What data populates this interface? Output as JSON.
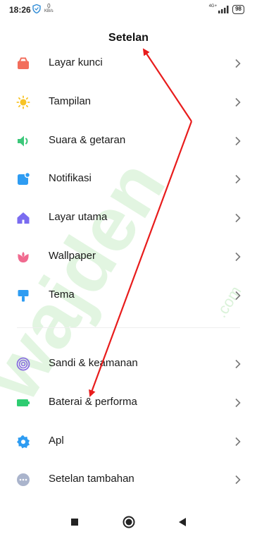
{
  "status_bar": {
    "time": "18:26",
    "speed_value": "0",
    "speed_unit": "KB/s",
    "network": "4G+",
    "battery": "98"
  },
  "header": {
    "title": "Setelan"
  },
  "settings": {
    "items": [
      {
        "label": "Layar kunci",
        "icon": "lock-screen-icon",
        "color": "#f26d5b"
      },
      {
        "label": "Tampilan",
        "icon": "sun-icon",
        "color": "#f7c325"
      },
      {
        "label": "Suara & getaran",
        "icon": "speaker-icon",
        "color": "#3cc77a"
      },
      {
        "label": "Notifikasi",
        "icon": "notification-icon",
        "color": "#2e9cf2"
      },
      {
        "label": "Layar utama",
        "icon": "home-icon",
        "color": "#7a6cf0"
      },
      {
        "label": "Wallpaper",
        "icon": "tulip-icon",
        "color": "#f06a8f"
      },
      {
        "label": "Tema",
        "icon": "paint-brush-icon",
        "color": "#2e9cf2"
      },
      {
        "label": "Sandi & keamanan",
        "icon": "fingerprint-icon",
        "color": "#8a6fe0"
      },
      {
        "label": "Baterai & performa",
        "icon": "battery-icon",
        "color": "#2ecc71"
      },
      {
        "label": "Apl",
        "icon": "gear-icon",
        "color": "#2e9cf2"
      },
      {
        "label": "Setelan tambahan",
        "icon": "more-icon",
        "color": "#8e9bb5"
      }
    ]
  },
  "watermark": {
    "text": "wajden",
    "suffix": ".com"
  },
  "nav_bar": {
    "recents": "square-icon",
    "home": "circle-icon",
    "back": "triangle-back-icon"
  },
  "annotation": {
    "color": "#e81c1c"
  }
}
